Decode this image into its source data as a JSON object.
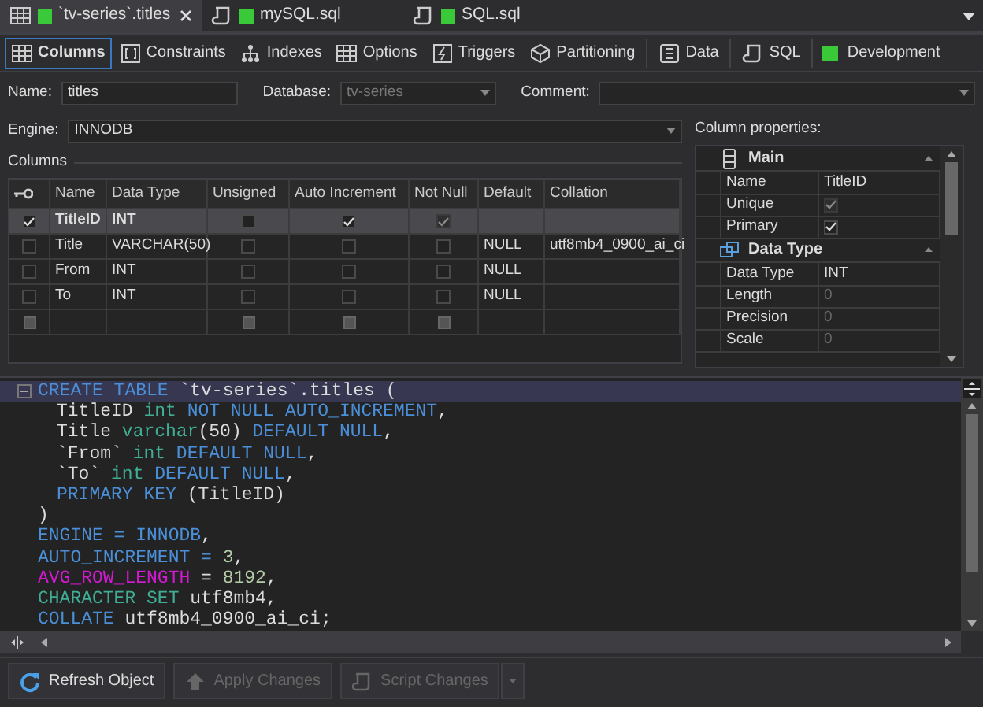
{
  "tabs": [
    {
      "label": "`tv-series`.titles",
      "selected": true,
      "color": "#39c939"
    },
    {
      "label": "mySQL.sql",
      "selected": false,
      "color": "#39c939"
    },
    {
      "label": "SQL.sql",
      "selected": false,
      "color": "#39c939"
    }
  ],
  "toolbar": {
    "items": [
      {
        "label": "Columns",
        "selected": true
      },
      {
        "label": "Constraints",
        "selected": false
      },
      {
        "label": "Indexes",
        "selected": false
      },
      {
        "label": "Options",
        "selected": false
      },
      {
        "label": "Triggers",
        "selected": false
      },
      {
        "label": "Partitioning",
        "selected": false
      },
      {
        "label": "Data",
        "selected": false
      },
      {
        "label": "SQL",
        "selected": false
      }
    ],
    "connection": {
      "label": "Development",
      "color": "#39c939"
    }
  },
  "form": {
    "name": {
      "label": "Name:",
      "value": "titles"
    },
    "database": {
      "label": "Database:",
      "value": "tv-series",
      "disabled": true
    },
    "comment": {
      "label": "Comment:"
    },
    "engine": {
      "label": "Engine:",
      "value": "INNODB"
    }
  },
  "columns_section": {
    "title": "Columns",
    "headers": [
      "Name",
      "Data Type",
      "Unsigned",
      "Auto Increment",
      "Not Null",
      "Default",
      "Collation"
    ],
    "rows": [
      {
        "kind": "data",
        "selected": true,
        "primary": {
          "checked": true,
          "disabled": false
        },
        "name": "TitleID",
        "data_type": "INT",
        "unsigned": {
          "checked": false,
          "disabled": false
        },
        "auto_increment": {
          "checked": true,
          "disabled": false
        },
        "not_null": {
          "checked": true,
          "disabled": true
        },
        "default": "",
        "collation": ""
      },
      {
        "kind": "data",
        "selected": false,
        "primary": {
          "checked": false,
          "disabled": false
        },
        "name": "Title",
        "data_type": "VARCHAR(50)",
        "unsigned": {
          "checked": false,
          "disabled": false
        },
        "auto_increment": {
          "checked": false,
          "disabled": false
        },
        "not_null": {
          "checked": false,
          "disabled": false
        },
        "default": "NULL",
        "collation": "utf8mb4_0900_ai_ci"
      },
      {
        "kind": "data",
        "selected": false,
        "primary": {
          "checked": false,
          "disabled": false
        },
        "name": "From",
        "data_type": "INT",
        "unsigned": {
          "checked": false,
          "disabled": false
        },
        "auto_increment": {
          "checked": false,
          "disabled": false
        },
        "not_null": {
          "checked": false,
          "disabled": false
        },
        "default": "NULL",
        "collation": ""
      },
      {
        "kind": "data",
        "selected": false,
        "primary": {
          "checked": false,
          "disabled": false
        },
        "name": "To",
        "data_type": "INT",
        "unsigned": {
          "checked": false,
          "disabled": false
        },
        "auto_increment": {
          "checked": false,
          "disabled": false
        },
        "not_null": {
          "checked": false,
          "disabled": false
        },
        "default": "NULL",
        "collation": ""
      },
      {
        "kind": "new",
        "selected": false
      }
    ]
  },
  "properties": {
    "title": "Column properties:",
    "groups": [
      {
        "title": "Main",
        "expanded": true,
        "rows": [
          {
            "name": "Name",
            "kind": "text",
            "value": "TitleID",
            "disabled": false
          },
          {
            "name": "Unique",
            "kind": "check",
            "checked": true,
            "disabled": true
          },
          {
            "name": "Primary",
            "kind": "check",
            "checked": true,
            "disabled": false
          }
        ]
      },
      {
        "title": "Data Type",
        "expanded": true,
        "rows": [
          {
            "name": "Data Type",
            "kind": "text",
            "value": "INT",
            "disabled": false
          },
          {
            "name": "Length",
            "kind": "text",
            "value": "0",
            "disabled": true
          },
          {
            "name": "Precision",
            "kind": "text",
            "value": "0",
            "disabled": true
          },
          {
            "name": "Scale",
            "kind": "text",
            "value": "0",
            "disabled": true
          }
        ]
      }
    ]
  },
  "editor": {
    "lines": [
      {
        "current": true,
        "fold": true,
        "indent": false,
        "tokens": [
          {
            "kind": "keyword",
            "text": "CREATE TABLE "
          },
          {
            "kind": "plain",
            "text": "`tv-series`.titles ("
          }
        ]
      },
      {
        "current": false,
        "fold": false,
        "indent": true,
        "tokens": [
          {
            "kind": "plain",
            "text": "TitleID "
          },
          {
            "kind": "type",
            "text": "int "
          },
          {
            "kind": "keyword",
            "text": "NOT NULL AUTO_INCREMENT"
          },
          {
            "kind": "plain",
            "text": ","
          }
        ]
      },
      {
        "current": false,
        "fold": false,
        "indent": true,
        "tokens": [
          {
            "kind": "plain",
            "text": "Title "
          },
          {
            "kind": "type",
            "text": "varchar"
          },
          {
            "kind": "plain",
            "text": "(50) "
          },
          {
            "kind": "keyword",
            "text": "DEFAULT NULL"
          },
          {
            "kind": "plain",
            "text": ","
          }
        ]
      },
      {
        "current": false,
        "fold": false,
        "indent": true,
        "tokens": [
          {
            "kind": "plain",
            "text": "`From` "
          },
          {
            "kind": "type",
            "text": "int "
          },
          {
            "kind": "keyword",
            "text": "DEFAULT NULL"
          },
          {
            "kind": "plain",
            "text": ","
          }
        ]
      },
      {
        "current": false,
        "fold": false,
        "indent": true,
        "tokens": [
          {
            "kind": "plain",
            "text": "`To` "
          },
          {
            "kind": "type",
            "text": "int "
          },
          {
            "kind": "keyword",
            "text": "DEFAULT NULL"
          },
          {
            "kind": "plain",
            "text": ","
          }
        ]
      },
      {
        "current": false,
        "fold": false,
        "indent": true,
        "tokens": [
          {
            "kind": "keyword",
            "text": "PRIMARY KEY "
          },
          {
            "kind": "plain",
            "text": "(TitleID)"
          }
        ]
      },
      {
        "current": false,
        "fold": false,
        "indent": false,
        "tokens": [
          {
            "kind": "plain",
            "text": ")"
          }
        ]
      },
      {
        "current": false,
        "fold": false,
        "indent": false,
        "tokens": [
          {
            "kind": "keyword",
            "text": "ENGINE = INNODB"
          },
          {
            "kind": "plain",
            "text": ","
          }
        ]
      },
      {
        "current": false,
        "fold": false,
        "indent": false,
        "tokens": [
          {
            "kind": "keyword",
            "text": "AUTO_INCREMENT = "
          },
          {
            "kind": "number",
            "text": "3"
          },
          {
            "kind": "plain",
            "text": ","
          }
        ]
      },
      {
        "current": false,
        "fold": false,
        "indent": false,
        "tokens": [
          {
            "kind": "variable",
            "text": "AVG_ROW_LENGTH"
          },
          {
            "kind": "plain",
            "text": " = "
          },
          {
            "kind": "number",
            "text": "8192"
          },
          {
            "kind": "plain",
            "text": ","
          }
        ]
      },
      {
        "current": false,
        "fold": false,
        "indent": false,
        "tokens": [
          {
            "kind": "type",
            "text": "CHARACTER SET "
          },
          {
            "kind": "plain",
            "text": "utf8mb4,"
          }
        ]
      },
      {
        "current": false,
        "fold": false,
        "indent": false,
        "tokens": [
          {
            "kind": "keyword",
            "text": "COLLATE "
          },
          {
            "kind": "plain",
            "text": "utf8mb4_0900_ai_ci;"
          }
        ]
      }
    ]
  },
  "buttons": [
    {
      "label": "Refresh Object",
      "disabled": false,
      "dropdown": false
    },
    {
      "label": "Apply Changes",
      "disabled": true,
      "dropdown": false
    },
    {
      "label": "Script Changes",
      "disabled": true,
      "dropdown": true
    }
  ]
}
